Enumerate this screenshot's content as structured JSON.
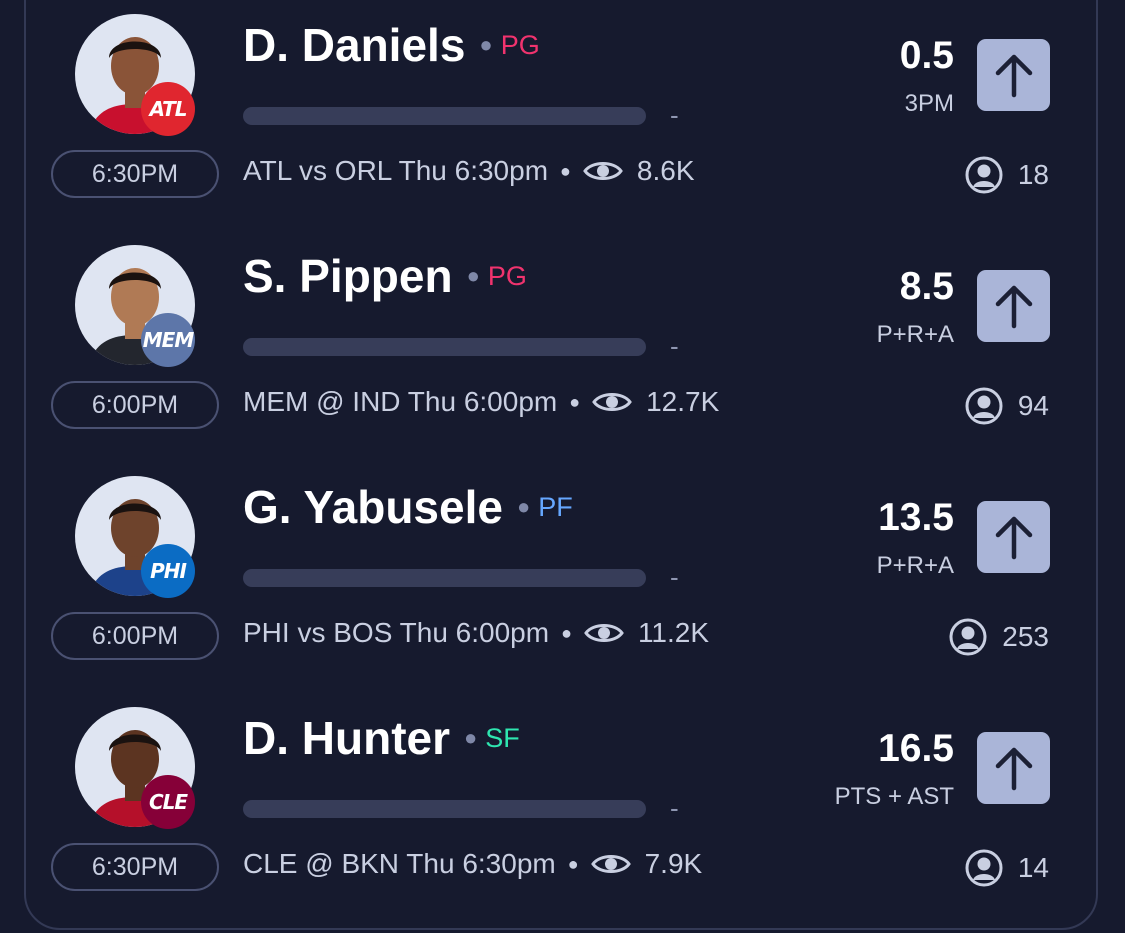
{
  "colors": {
    "background": "#161a2e",
    "pg": "#f0336e",
    "pf": "#66a7ff",
    "sf": "#2ee6b0",
    "button": "#aab5d8"
  },
  "players": [
    {
      "name": "D. Daniels",
      "position": "PG",
      "position_color": "#f0336e",
      "team": "ATL",
      "team_color": "#e0262f",
      "line": "0.5",
      "stat": "3PM",
      "time": "6:30PM",
      "game": "ATL vs ORL Thu 6:30pm",
      "views": "8.6K",
      "users": "18",
      "skin": "#8a5438",
      "jersey": "#c8102e"
    },
    {
      "name": "S. Pippen",
      "position": "PG",
      "position_color": "#f0336e",
      "team": "MEM",
      "team_color": "#5d76a9",
      "line": "8.5",
      "stat": "P+R+A",
      "time": "6:00PM",
      "game": "MEM @ IND Thu 6:00pm",
      "views": "12.7K",
      "users": "94",
      "skin": "#b07a55",
      "jersey": "#23262e"
    },
    {
      "name": "G. Yabusele",
      "position": "PF",
      "position_color": "#66a7ff",
      "team": "PHI",
      "team_color": "#0b6cc4",
      "line": "13.5",
      "stat": "P+R+A",
      "time": "6:00PM",
      "game": "PHI vs BOS Thu 6:00pm",
      "views": "11.2K",
      "users": "253",
      "skin": "#6e432c",
      "jersey": "#1d428a"
    },
    {
      "name": "D. Hunter",
      "position": "SF",
      "position_color": "#2ee6b0",
      "team": "CLE",
      "team_color": "#860038",
      "line": "16.5",
      "stat": "PTS + AST",
      "time": "6:30PM",
      "game": "CLE @ BKN Thu 6:30pm",
      "views": "7.9K",
      "users": "14",
      "skin": "#5c3421",
      "jersey": "#b5102a"
    }
  ],
  "icons": {
    "view_icon": "eye-icon",
    "user_icon": "user-circle-icon",
    "pick_icon": "arrow-up-icon"
  }
}
